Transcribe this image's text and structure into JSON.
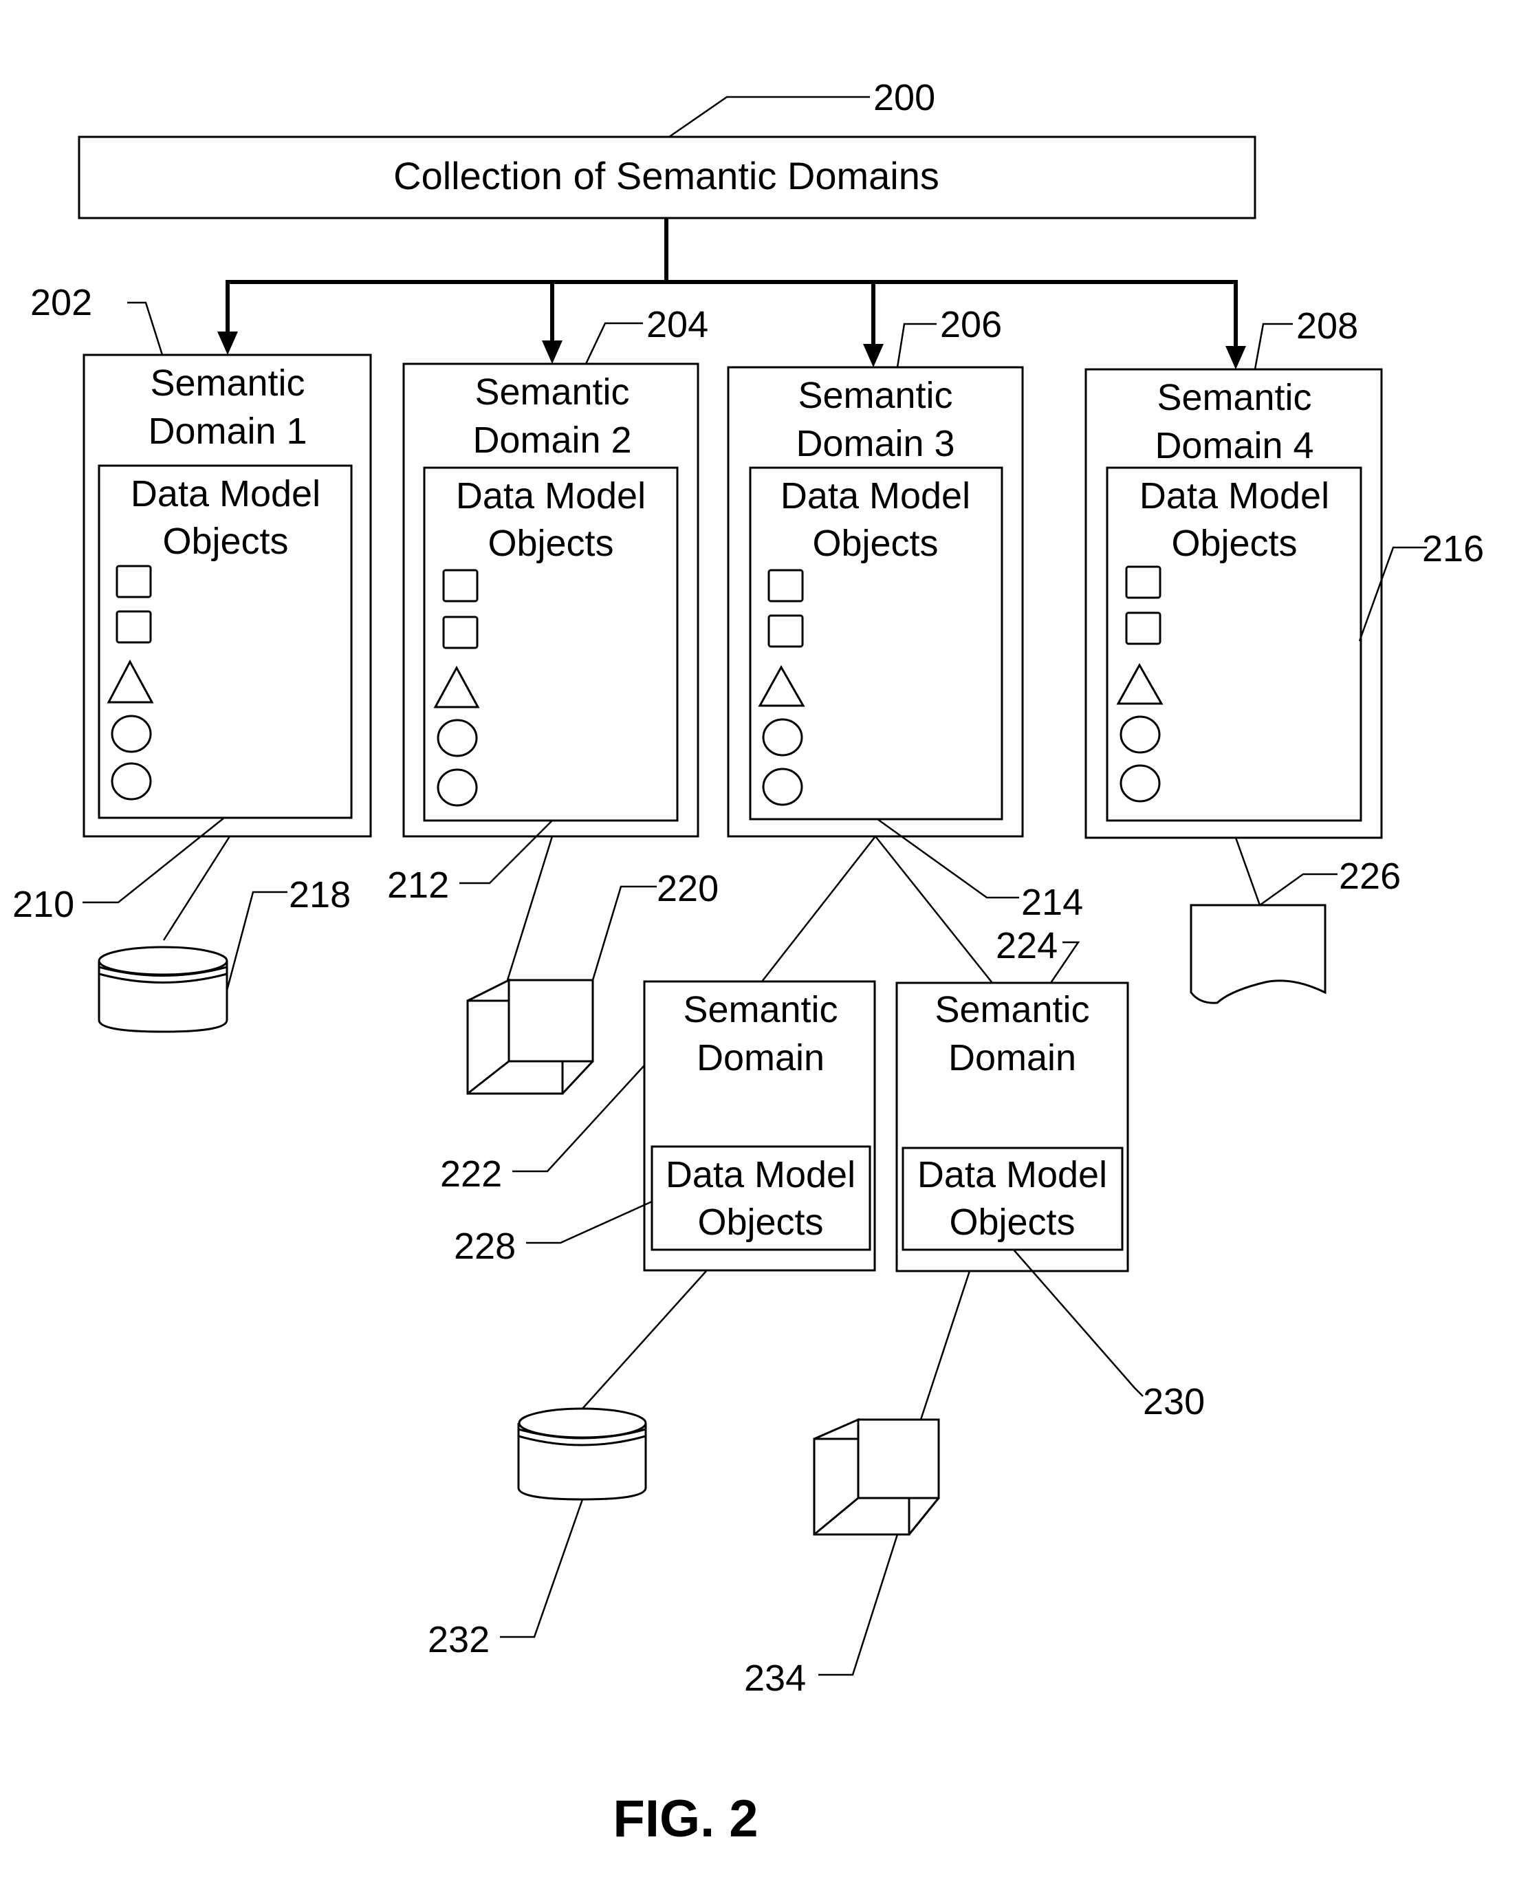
{
  "figure": {
    "caption": "FIG. 2",
    "root": {
      "label": "Collection of Semantic Domains",
      "ref": "200"
    },
    "domains": [
      {
        "title_line1": "Semantic",
        "title_line2": "Domain 1",
        "ref": "202",
        "dmo_line1": "Data Model",
        "dmo_line2": "Objects",
        "dmo_ref": "210",
        "source_ref": "218",
        "source_type": "database-cylinder"
      },
      {
        "title_line1": "Semantic",
        "title_line2": "Domain 2",
        "ref": "204",
        "dmo_line1": "Data Model",
        "dmo_line2": "Objects",
        "dmo_ref": "212",
        "source_ref": "220",
        "source_type": "cube"
      },
      {
        "title_line1": "Semantic",
        "title_line2": "Domain 3",
        "ref": "206",
        "dmo_line1": "Data Model",
        "dmo_line2": "Objects",
        "dmo_ref": "214"
      },
      {
        "title_line1": "Semantic",
        "title_line2": "Domain 4",
        "ref": "208",
        "dmo_line1": "Data Model",
        "dmo_line2": "Objects",
        "dmo_ref": "216",
        "source_ref": "226",
        "source_type": "document"
      }
    ],
    "object_shapes": [
      "square",
      "square",
      "triangle",
      "circle",
      "circle"
    ],
    "sub_domains": [
      {
        "title_line1": "Semantic",
        "title_line2": "Domain",
        "ref": "222",
        "dmo_line1": "Data Model",
        "dmo_line2": "Objects",
        "dmo_ref": "228",
        "source_ref": "232",
        "source_type": "database-cylinder"
      },
      {
        "title_line1": "Semantic",
        "title_line2": "Domain",
        "ref": "224",
        "dmo_line1": "Data Model",
        "dmo_line2": "Objects",
        "dmo_ref": "230",
        "source_ref": "234",
        "source_type": "cube"
      }
    ]
  }
}
